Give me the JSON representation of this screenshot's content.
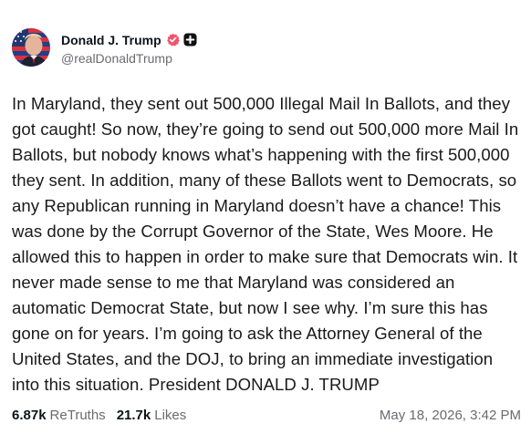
{
  "author": {
    "display_name": "Donald J. Trump",
    "handle": "@realDonaldTrump",
    "avatar_icon": "portrait-with-flag-avatar",
    "verified_icon": "verified-badge-icon",
    "verified_color": "#f0556b",
    "plus_icon": "plus-badge-icon"
  },
  "post": {
    "text": "In Maryland, they sent out 500,000 Illegal Mail In Ballots, and they got caught! So now, they’re going to send out 500,000 more Mail In Ballots, but nobody knows what’s happening with the first 500,000 they sent. In addition, many of these Ballots went to Democrats, so any Republican running in Maryland doesn’t have a chance! This was done by the Corrupt Governor of the State, Wes Moore. He allowed this to happen in order to make sure that Democrats win. It never made sense to me that Maryland was considered an automatic Democrat State, but now I see why. I’m sure this has gone on for years. I’m going to ask the Attorney General of the United States, and the DOJ, to bring an immediate investigation into this situation. President DONALD J. TRUMP"
  },
  "stats": {
    "retruths_count": "6.87k",
    "retruths_label": "ReTruths",
    "likes_count": "21.7k",
    "likes_label": "Likes"
  },
  "timestamp": "May 18, 2026, 3:42 PM"
}
